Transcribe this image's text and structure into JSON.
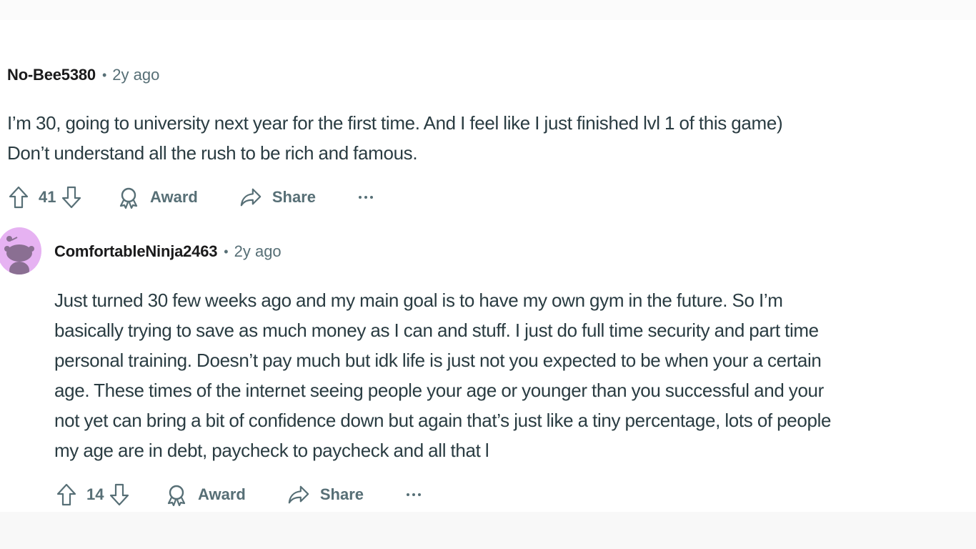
{
  "comments": [
    {
      "author": "No-Bee5380",
      "separator": "•",
      "age": "2y ago",
      "body_lines": [
        "I’m 30, going to university next year for the first time. And I feel like I just finished lvl 1 of this game)",
        "Don’t understand all the rush to be rich and famous."
      ],
      "votes": "41",
      "award_label": "Award",
      "share_label": "Share",
      "more_label": "···"
    },
    {
      "author": "ComfortableNinja2463",
      "separator": "•",
      "age": "2y ago",
      "body_lines": [
        "Just turned 30 few weeks ago and my main goal is to have my own gym in the future. So I’m",
        "basically trying to save as much money as I can and stuff. I just do full time security and part time",
        "personal training. Doesn’t pay much but idk life is just not you expected to be when your a certain",
        "age. These times of the internet seeing people your age or younger than you successful and your",
        "not yet can bring a bit of confidence down but again that’s just like a tiny percentage, lots of people",
        "my age are in debt, paycheck to paycheck and all that l"
      ],
      "votes": "14",
      "award_label": "Award",
      "share_label": "Share",
      "more_label": "···"
    }
  ],
  "icons": {
    "upvote": "upvote-arrow-icon",
    "downvote": "downvote-arrow-icon",
    "award": "award-ribbon-icon",
    "share": "share-arrow-icon",
    "more": "more-dots-icon",
    "avatar": "snoo-avatar"
  },
  "colors": {
    "meta_text": "#576f76",
    "body_text": "#2a3c42",
    "avatar_bg": "#e6b2f2",
    "avatar_figure": "#8a6f92"
  }
}
